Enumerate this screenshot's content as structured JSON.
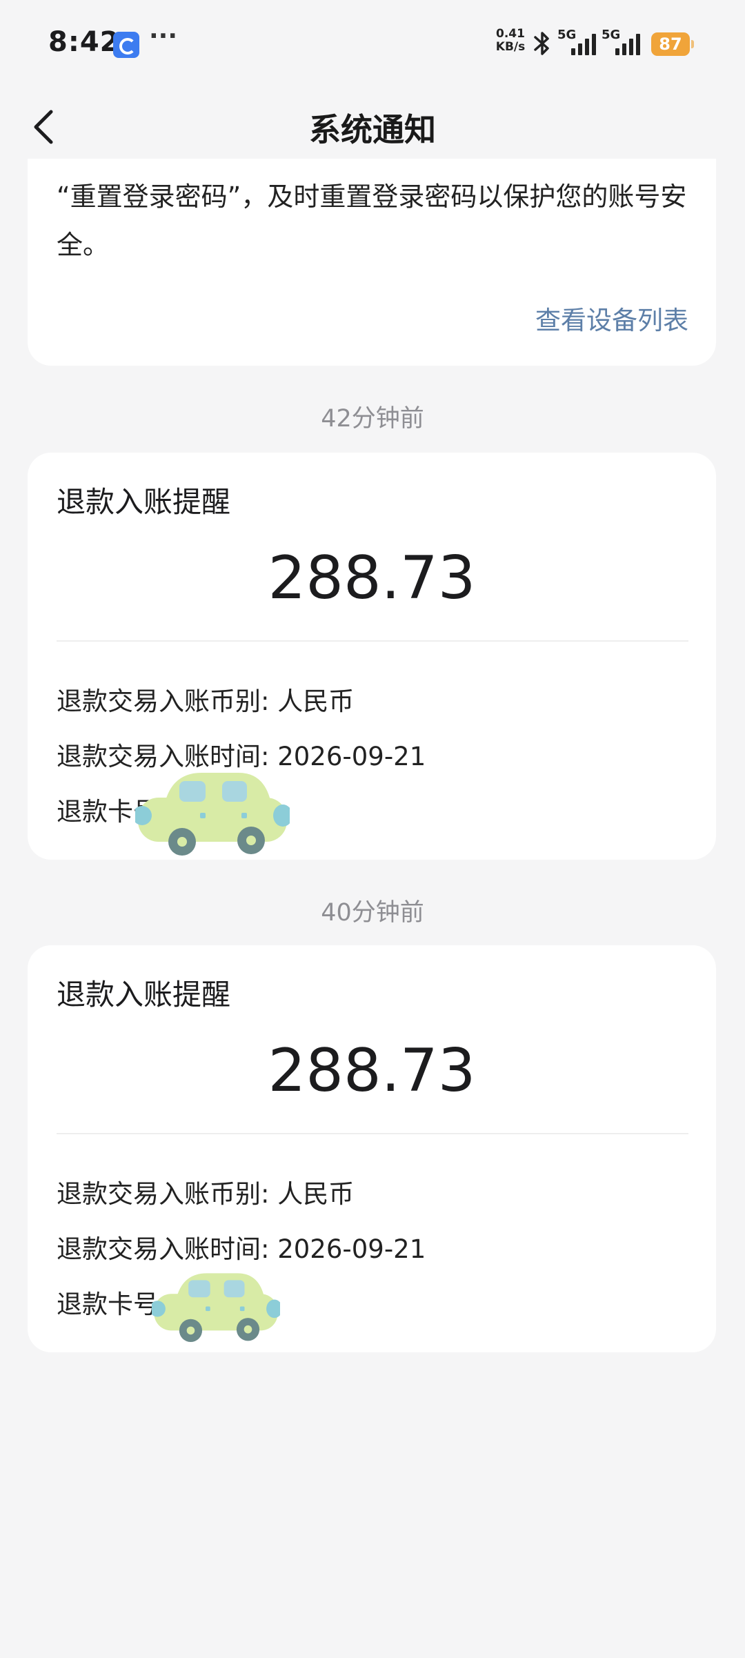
{
  "status_bar": {
    "time": "8:42",
    "more": "···",
    "net_speed_value": "0.41",
    "net_speed_unit": "KB/s",
    "sim1_label": "5G",
    "sim2_label": "5G",
    "battery": "87",
    "icons": [
      "app-icon",
      "bluetooth-icon",
      "signal-icon",
      "battery-icon"
    ]
  },
  "nav": {
    "title": "系统通知",
    "back_icon": "chevron-left-icon"
  },
  "notifications": {
    "top_card": {
      "body": "“重置登录密码”，及时重置登录密码以保护您的账号安全。",
      "link": "查看设备列表"
    },
    "refund_cards": [
      {
        "time": "42分钟前",
        "title": "退款入账提醒",
        "amount": "288.73",
        "currency_row": "退款交易入账币别: 人民币",
        "date_row": "退款交易入账时间: 2026-09-21",
        "card_row": "退款卡号"
      },
      {
        "time": "40分钟前",
        "title": "退款入账提醒",
        "amount": "288.73",
        "currency_row": "退款交易入账币别: 人民币",
        "date_row": "退款交易入账时间: 2026-09-21",
        "card_row": "退款卡号"
      }
    ]
  },
  "colors": {
    "background": "#f5f5f6",
    "card": "#ffffff",
    "link": "#5d7fa8",
    "muted_text": "#8e8e93",
    "battery": "#f0a43a",
    "sticker_body": "#d8eba6",
    "sticker_window": "#a9d6e0",
    "sticker_wheel": "#6b8a8a"
  }
}
